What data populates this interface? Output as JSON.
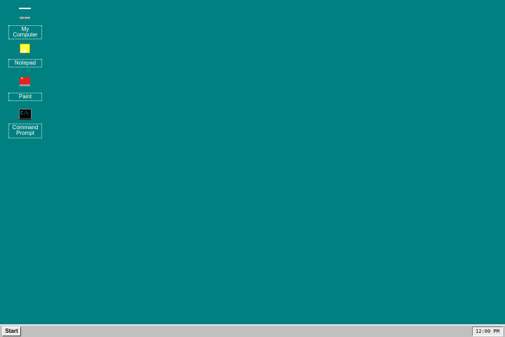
{
  "desktop": {
    "background_color": "#008080",
    "icons": [
      {
        "label": "My Computer",
        "icon": "computer-icon"
      },
      {
        "label": "Notepad",
        "icon": "notepad-icon"
      },
      {
        "label": "Paint",
        "icon": "paint-icon"
      },
      {
        "label": "Command Prompt",
        "icon": "command-prompt-icon",
        "glyph_text": "C:\\"
      }
    ]
  },
  "taskbar": {
    "start_label": "Start",
    "clock": "12:00 PM"
  }
}
